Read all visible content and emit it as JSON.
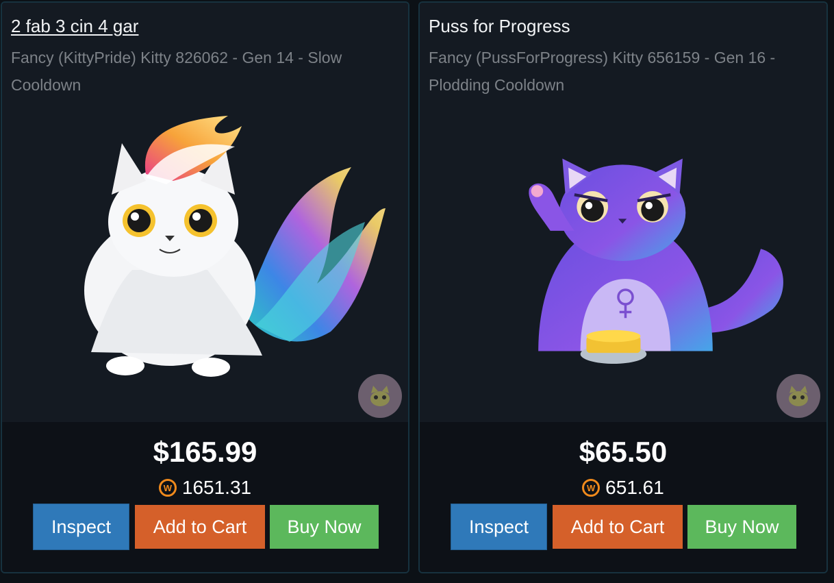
{
  "cards": [
    {
      "title": "2 fab 3 cin 4 gar",
      "subtitle": "Fancy (KittyPride) Kitty 826062 - Gen 14 - Slow Cooldown",
      "price": "$165.99",
      "wpeg": "1651.31",
      "buttons": {
        "inspect": "Inspect",
        "cart": "Add to Cart",
        "buy": "Buy Now"
      }
    },
    {
      "title": "Puss for Progress",
      "subtitle": "Fancy (PussForProgress) Kitty 656159 - Gen 16 - Plodding Cooldown",
      "price": "$65.50",
      "wpeg": "651.61",
      "buttons": {
        "inspect": "Inspect",
        "cart": "Add to Cart",
        "buy": "Buy Now"
      }
    }
  ],
  "colors": {
    "inspect": "#2f79b9",
    "cart": "#d5602a",
    "buy": "#5cb85c",
    "wax": "#f08a1c"
  },
  "icons": [
    "kitty-pride-cat-image",
    "puss-for-progress-cat-image",
    "cattribute-badge-icon",
    "wax-token-icon"
  ]
}
